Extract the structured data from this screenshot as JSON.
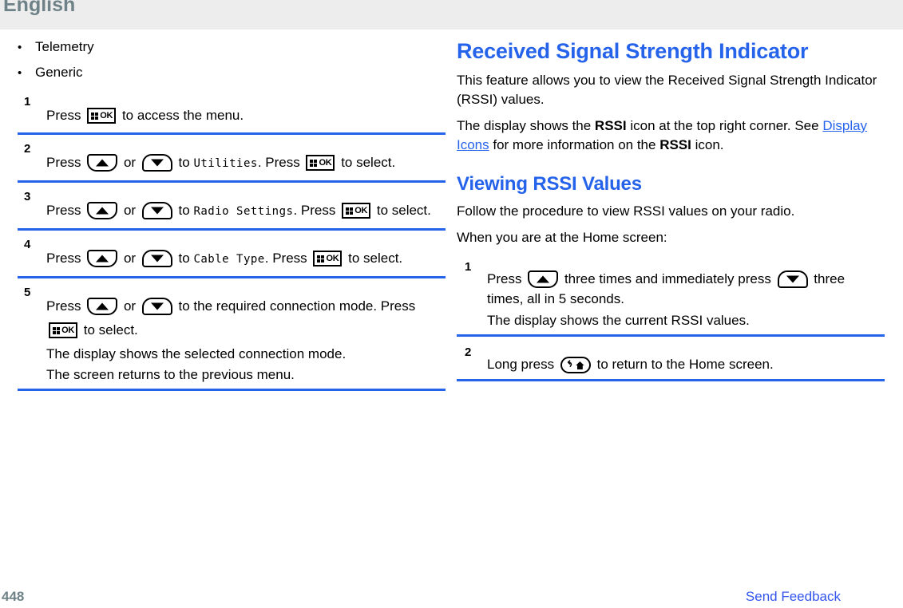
{
  "header": {
    "title": "English"
  },
  "footer": {
    "page_number": "448",
    "feedback_label": "Send Feedback"
  },
  "icons": {
    "ok_key": "ok-key-icon",
    "up_key": "up-arrow-key-icon",
    "down_key": "down-arrow-key-icon",
    "back_home_key": "back-home-key-icon",
    "ok_label": "OK"
  },
  "left_column": {
    "bullets": [
      {
        "marker": "•",
        "label": "Telemetry"
      },
      {
        "marker": "•",
        "label": "Generic"
      }
    ],
    "steps": [
      {
        "number": "1",
        "seg1": "Press",
        "seg2": "to access the menu."
      },
      {
        "number": "2",
        "seg1": "Press",
        "seg2": "or",
        "seg3": "to",
        "menu": "Utilities",
        "seg4": ". Press",
        "seg5": "to select."
      },
      {
        "number": "3",
        "seg1": "Press",
        "seg2": "or",
        "seg3": "to",
        "menu": "Radio Settings",
        "seg4": ". Press",
        "seg5": "to select."
      },
      {
        "number": "4",
        "seg1": "Press",
        "seg2": "or",
        "seg3": "to",
        "menu": "Cable Type",
        "seg4": ". Press",
        "seg5": "to select."
      },
      {
        "number": "5",
        "seg1": "Press",
        "seg2": "or",
        "seg3": "to the required connection mode. Press",
        "seg4": "to select.",
        "note1": "The display shows the selected connection mode.",
        "note2": "The screen returns to the previous menu."
      }
    ]
  },
  "right_column": {
    "heading": "Received Signal Strength Indicator",
    "intro": "This feature allows you to view the Received Signal Strength Indicator (RSSI) values.",
    "para2_a": "The display shows the ",
    "para2_rssi1": "RSSI",
    "para2_b": " icon at the top right corner. See ",
    "para2_link": "Display Icons",
    "para2_c": " for more information on the ",
    "para2_rssi2": "RSSI",
    "para2_d": " icon.",
    "subheading": "Viewing RSSI Values",
    "para3": "Follow the procedure to view RSSI values on your radio.",
    "para4": "When you are at the Home screen:",
    "steps": [
      {
        "number": "1",
        "seg1": "Press",
        "seg2": "three times and immediately press",
        "seg3": "three times, all in 5 seconds.",
        "note1": "The display shows the current RSSI values."
      },
      {
        "number": "2",
        "seg1": "Long press",
        "seg2": "to return to the Home screen."
      }
    ]
  },
  "colors": {
    "accent_blue": "#2563eb",
    "link_blue": "#3355ee",
    "header_gray": "#6e8287",
    "header_band": "#ededed"
  }
}
